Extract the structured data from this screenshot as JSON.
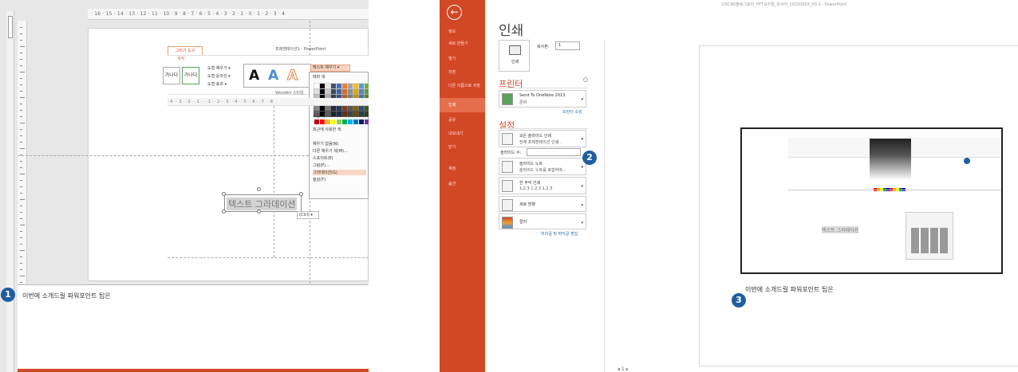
{
  "left_editor": {
    "ruler_text": "· 16 · 15 · 14 · 13 · 12 · 11 · 10 · 9 · 8 · 7 · 6 · 5 · 4 · 3 · 2 · 1 · 0 · 1 · 2 · 3 · 4",
    "window_title": "프레젠테이션1 - PowerPoint",
    "context_tab": "그리기 도구",
    "format_tab": "서식",
    "shape_styles": [
      "가나다",
      "가나다"
    ],
    "shape_commands": [
      "도형 채우기 ▾",
      "도형 윤곽선 ▾",
      "도형 효과 ▾"
    ],
    "wordart_label": "WordArt 스타일",
    "wordart_letters": [
      "A",
      "A",
      "A"
    ],
    "text_fill_button": "텍스트 채우기 ▾",
    "theme_colors_label": "테마 색",
    "standard_colors_label": "표준 색",
    "recent_colors_label": "최근에 사용한 색",
    "menu_items": [
      "채우기 없음(N)",
      "다른 채우기 색(M)...",
      "스포이트(E)",
      "그림(P)...",
      "그라데이션(G)",
      "질감(T)"
    ],
    "sub_ruler": "· 4 · · 3 · · 2 · · 1 · · · 1 · · 2 · · 3 · · 4 · · 5 · · 6 · · 7 · · 8",
    "textbox_text": "텍스트 그라데이션",
    "ctrl_label": "(Ctrl) ▾",
    "badge": "1",
    "notes_text": "이번에 소개드릴 파워포인트 팁은"
  },
  "backstage": {
    "doc_title": "USCNS블로그용자_PPT교수법_강사러_20150603_V0.2 - PowerPoint",
    "nav": [
      "정보",
      "새로 만들기",
      "열기",
      "저장",
      "다른 이름으로 저장",
      "인쇄",
      "공유",
      "내보내기",
      "닫기",
      "계정",
      "옵션"
    ],
    "active_nav": "인쇄",
    "heading": "인쇄",
    "print_button": "인쇄",
    "copies_label": "복사본:",
    "copies_value": "1",
    "printer_heading": "프린터",
    "printer_name": "Send To OneNote 2013",
    "printer_status": "준비",
    "printer_props": "프린터 속성",
    "settings_heading": "설정",
    "settings": [
      {
        "t1": "모든 슬라이드 인쇄",
        "t2": "전체 프레젠테이션 인쇄..."
      },
      {
        "t1": "슬라이드 노트",
        "t2": "슬라이드 노트를 포함하여..."
      },
      {
        "t1": "한 부씩 인쇄",
        "t2": "1,2,3    1,2,3    1,2,3"
      },
      {
        "t1": "세로 방향",
        "t2": ""
      },
      {
        "t1": "컬러",
        "t2": ""
      }
    ],
    "slides_label": "슬라이드 수:",
    "header_footer_link": "머리글 및 바닥글 편집",
    "badge2": "2",
    "badge3": "3",
    "preview_notes": "이번에 소개드릴 파워포인트 팁은",
    "preview_textbox": "텍스트 그라데이션",
    "page_nav": "◂ 1 ▸"
  },
  "colors": {
    "accent": "#d24726",
    "badge": "#1f5f9e"
  }
}
